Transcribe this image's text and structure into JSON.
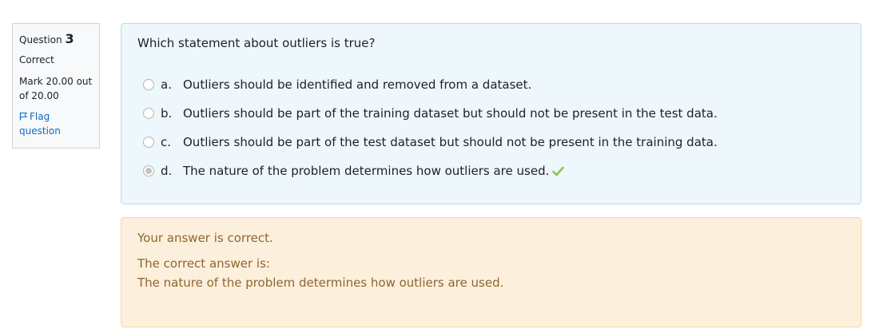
{
  "info": {
    "question_prefix": "Question",
    "question_number": "3",
    "state": "Correct",
    "grade": "Mark 20.00 out of 20.00",
    "flag_label": "Flag question",
    "flag_icon": "flag-icon"
  },
  "question": {
    "text": "Which statement about outliers is true?",
    "options": [
      {
        "letter": "a.",
        "text": "Outliers should be identified and removed from a dataset.",
        "selected": false
      },
      {
        "letter": "b.",
        "text": "Outliers should be part of the training dataset but should not be present in the test data.",
        "selected": false
      },
      {
        "letter": "c.",
        "text": "Outliers should be part of the test dataset but should not be present in the training data.",
        "selected": false
      },
      {
        "letter": "d.",
        "text": "The nature of the problem determines how outliers are used.",
        "selected": true,
        "icon": "checkmark-icon"
      }
    ]
  },
  "feedback": {
    "specific": "Your answer is correct.",
    "right_answer_label": "The correct answer is:",
    "right_answer": "The nature of the problem determines how outliers are used."
  },
  "colors": {
    "info_bg": "#f8f9fa",
    "formulation_bg": "#eef7fb",
    "feedback_bg": "#fcefdc",
    "feedback_text": "#8e662e",
    "link": "#0f6cbf",
    "correct_check": "#8bc34a"
  }
}
